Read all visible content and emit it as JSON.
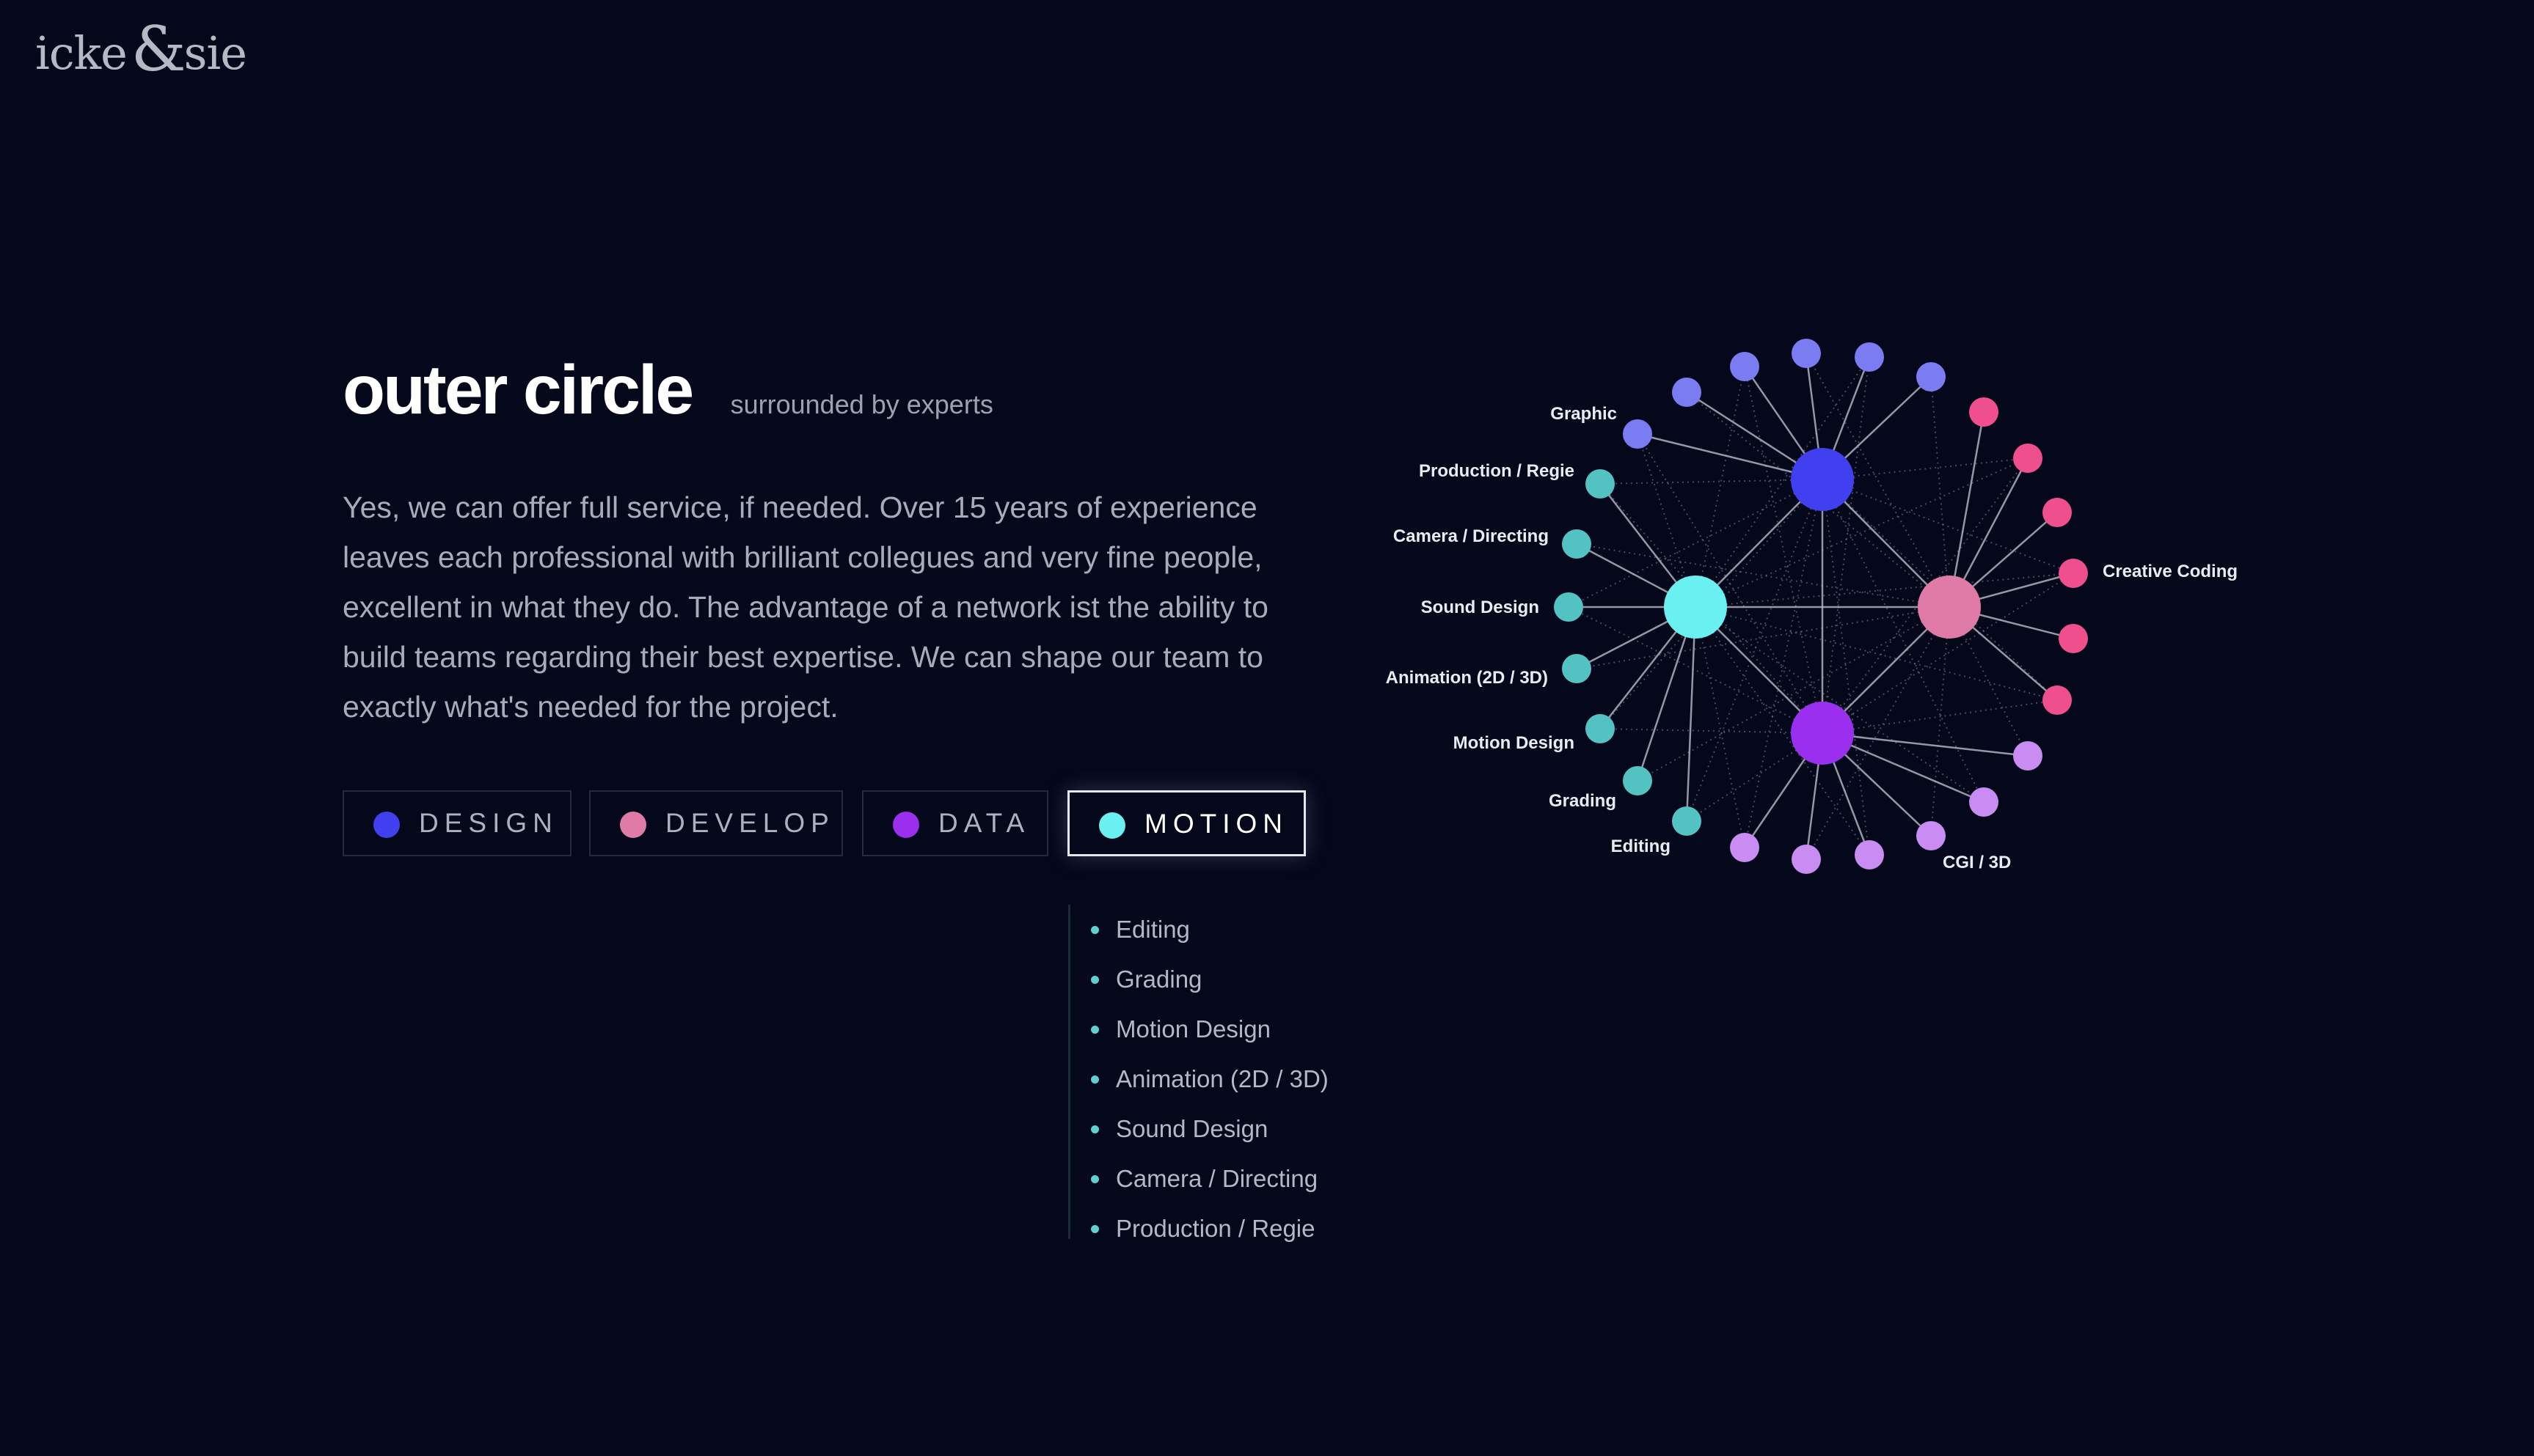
{
  "brand": {
    "logo_left": "icke",
    "logo_amp": "&",
    "logo_right": "sie"
  },
  "section": {
    "title": "outer circle",
    "subtitle": "surrounded by experts",
    "intro": "Yes, we can offer full service, if needed. Over 15 years of experience leaves each professional with brilliant collegues and very fine people, excellent in what they do. The advantage of a network ist the ability to build teams regarding their best expertise. We can shape our team to exactly what's needed for the project."
  },
  "filters": [
    {
      "label": "DESIGN",
      "color": "#4040f0",
      "active": false
    },
    {
      "label": "DEVELOP",
      "color": "#e07aa6",
      "active": false
    },
    {
      "label": "DATA",
      "color": "#9a2ff0",
      "active": false
    },
    {
      "label": "MOTION",
      "color": "#6af0f0",
      "active": true
    }
  ],
  "skills": [
    "Editing",
    "Grading",
    "Motion Design",
    "Animation (2D / 3D)",
    "Sound Design",
    "Camera / Directing",
    "Production / Regie"
  ],
  "network": {
    "colors": {
      "design": "#4040f0",
      "design_leaf": "#7b7cf2",
      "develop": "#e07aa6",
      "develop_leaf": "#ef4f8c",
      "data": "#9a2ff0",
      "data_leaf": "#c98cf3",
      "motion": "#6af0f0",
      "motion_leaf": "#52c2c2"
    },
    "labels": {
      "graphic": "Graphic",
      "production_regie": "Production / Regie",
      "camera_directing": "Camera / Directing",
      "sound_design": "Sound Design",
      "animation": "Animation (2D / 3D)",
      "motion_design": "Motion Design",
      "grading": "Grading",
      "editing": "Editing",
      "creative_coding": "Creative Coding",
      "cgi_3d": "CGI / 3D"
    }
  }
}
